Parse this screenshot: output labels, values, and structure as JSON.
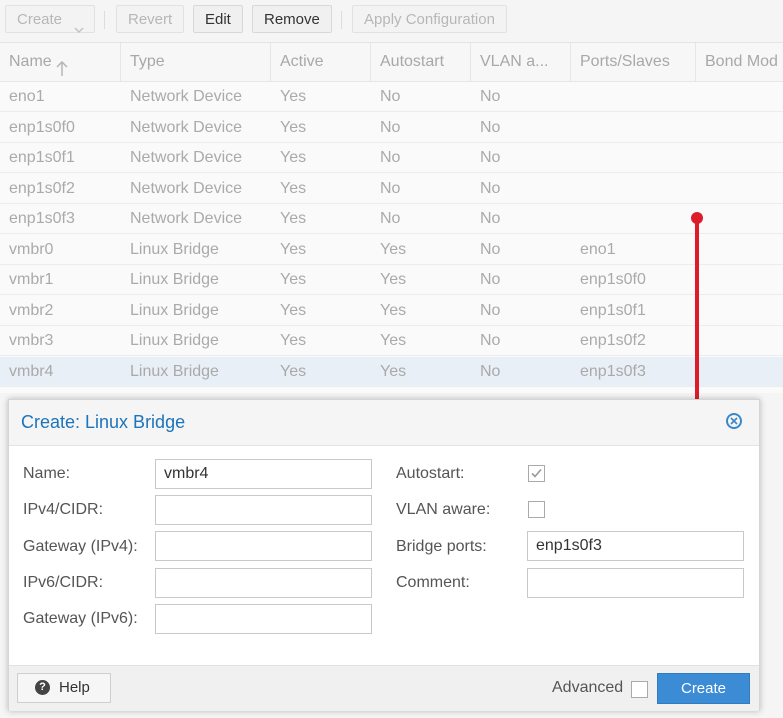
{
  "toolbar": {
    "create": "Create",
    "revert": "Revert",
    "edit": "Edit",
    "remove": "Remove",
    "apply": "Apply Configuration"
  },
  "grid": {
    "columns": [
      "Name",
      "Type",
      "Active",
      "Autostart",
      "VLAN a...",
      "Ports/Slaves",
      "Bond Mod"
    ],
    "rows": [
      {
        "name": "eno1",
        "type": "Network Device",
        "active": "Yes",
        "autostart": "No",
        "vlan": "No",
        "ports": ""
      },
      {
        "name": "enp1s0f0",
        "type": "Network Device",
        "active": "Yes",
        "autostart": "No",
        "vlan": "No",
        "ports": ""
      },
      {
        "name": "enp1s0f1",
        "type": "Network Device",
        "active": "Yes",
        "autostart": "No",
        "vlan": "No",
        "ports": ""
      },
      {
        "name": "enp1s0f2",
        "type": "Network Device",
        "active": "Yes",
        "autostart": "No",
        "vlan": "No",
        "ports": ""
      },
      {
        "name": "enp1s0f3",
        "type": "Network Device",
        "active": "Yes",
        "autostart": "No",
        "vlan": "No",
        "ports": ""
      },
      {
        "name": "vmbr0",
        "type": "Linux Bridge",
        "active": "Yes",
        "autostart": "Yes",
        "vlan": "No",
        "ports": "eno1"
      },
      {
        "name": "vmbr1",
        "type": "Linux Bridge",
        "active": "Yes",
        "autostart": "Yes",
        "vlan": "No",
        "ports": "enp1s0f0"
      },
      {
        "name": "vmbr2",
        "type": "Linux Bridge",
        "active": "Yes",
        "autostart": "Yes",
        "vlan": "No",
        "ports": "enp1s0f1"
      },
      {
        "name": "vmbr3",
        "type": "Linux Bridge",
        "active": "Yes",
        "autostart": "Yes",
        "vlan": "No",
        "ports": "enp1s0f2"
      },
      {
        "name": "vmbr4",
        "type": "Linux Bridge",
        "active": "Yes",
        "autostart": "Yes",
        "vlan": "No",
        "ports": "enp1s0f3"
      }
    ]
  },
  "dialog": {
    "title": "Create: Linux Bridge",
    "labels": {
      "name": "Name:",
      "ipv4": "IPv4/CIDR:",
      "gw4": "Gateway (IPv4):",
      "ipv6": "IPv6/CIDR:",
      "gw6": "Gateway (IPv6):",
      "autostart": "Autostart:",
      "vlan": "VLAN aware:",
      "ports": "Bridge ports:",
      "comment": "Comment:"
    },
    "values": {
      "name": "vmbr4",
      "ipv4": "",
      "gw4": "",
      "ipv6": "",
      "gw6": "",
      "ports": "enp1s0f3",
      "comment": ""
    },
    "help": "Help",
    "advanced": "Advanced",
    "create": "Create"
  },
  "colors": {
    "accent": "#3b8bd5",
    "title": "#1c74bb",
    "annotation": "#dd1c2a"
  }
}
